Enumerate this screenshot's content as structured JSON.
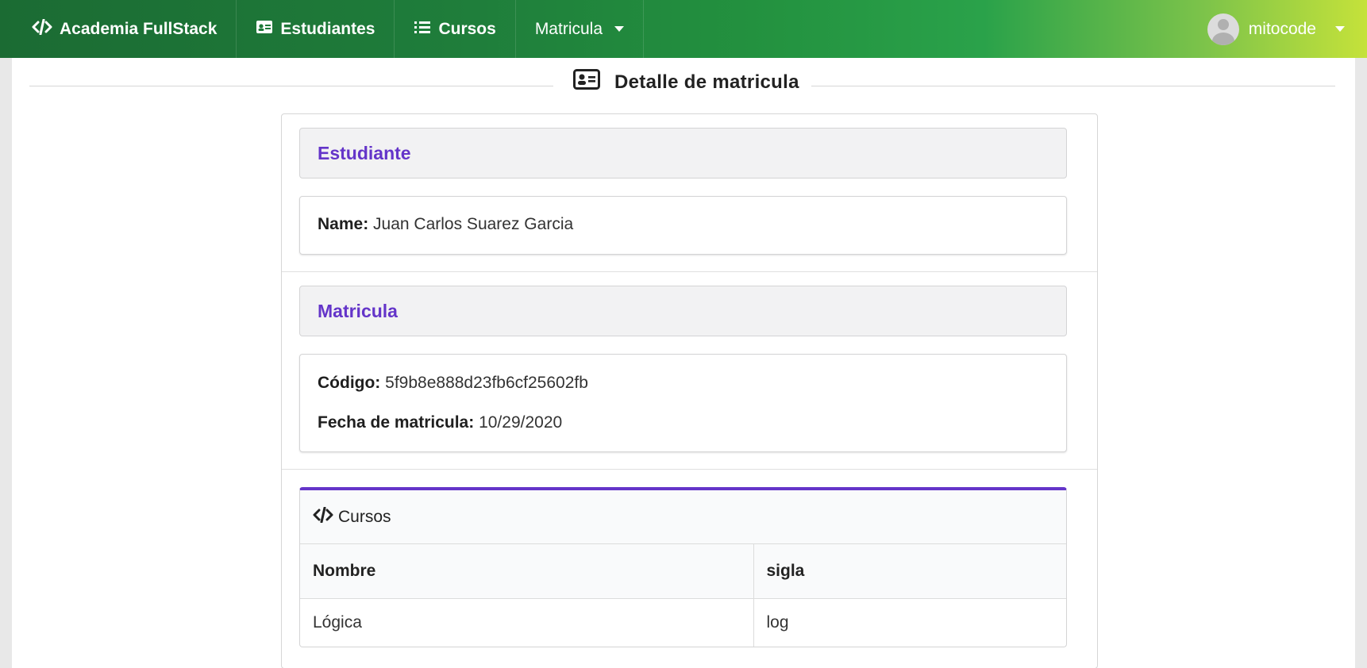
{
  "navbar": {
    "brand": "Academia FullStack",
    "items": [
      {
        "label": "Estudiantes",
        "icon": "id-card-icon"
      },
      {
        "label": "Cursos",
        "icon": "list-icon"
      },
      {
        "label": "Matricula",
        "icon": "caret-down-icon"
      }
    ],
    "user": {
      "name": "mitocode",
      "icon": "user-avatar-icon"
    }
  },
  "page": {
    "title": "Detalle de matricula",
    "title_icon": "address-card-icon"
  },
  "estudiante": {
    "header": "Estudiante",
    "name_label": "Name:",
    "name_value": "Juan Carlos Suarez Garcia"
  },
  "matricula": {
    "header": "Matricula",
    "codigo_label": "Código:",
    "codigo_value": "5f9b8e888d23fb6cf25602fb",
    "fecha_label": "Fecha de matricula:",
    "fecha_value": "10/29/2020"
  },
  "cursos": {
    "title": "Cursos",
    "title_icon": "code-icon",
    "columns": [
      "Nombre",
      "sigla"
    ],
    "rows": [
      {
        "nombre": "Lógica",
        "sigla": "log"
      }
    ]
  },
  "colors": {
    "accent": "#6435c9",
    "nav_start": "#1b6b33",
    "nav_end": "#c5e23a"
  }
}
